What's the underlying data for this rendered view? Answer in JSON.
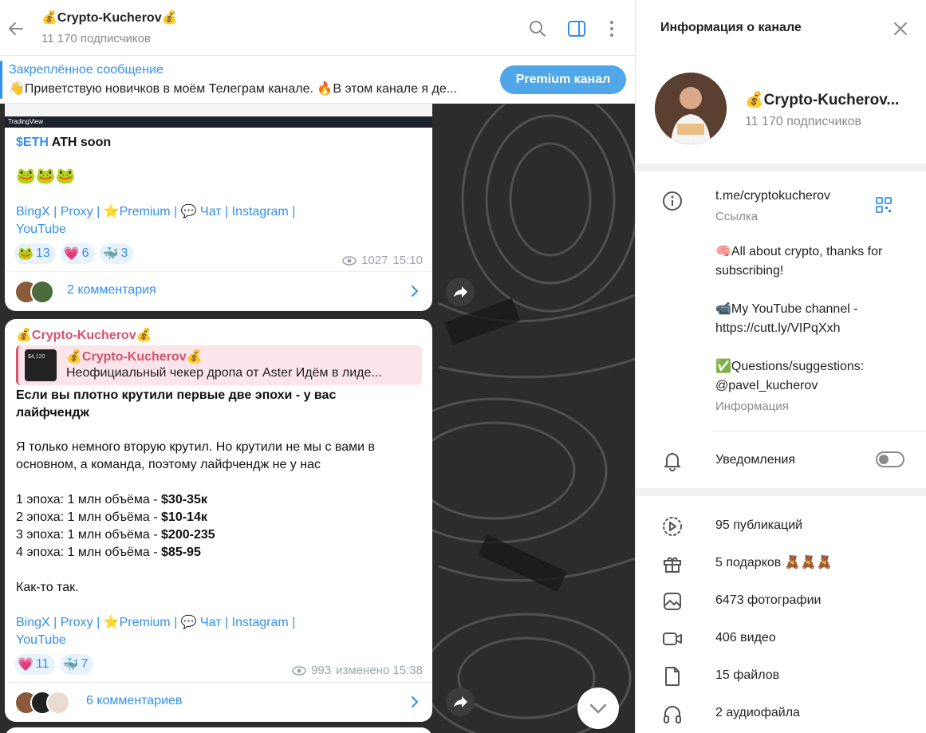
{
  "chat": {
    "title": "💰Crypto-Kucherov💰",
    "subscribers": "11 170 подписчиков",
    "pinned_title": "Закреплённое сообщение",
    "pinned_text": "👋Приветствую новичков в моём Телеграм канале.  🔥В этом канале я де...",
    "premium_button": "Premium канал"
  },
  "post1": {
    "tv_logo": "TradingView",
    "line1_ticker": "$ETH",
    "line1_rest": " ATH soon",
    "emojis": "🐸🐸🐸",
    "links_line1": "BingX | Proxy | ⭐Premium | 💬 Чат | Instagram |",
    "links_line2": "YouTube",
    "reactions": [
      {
        "emoji": "🐸",
        "count": "13"
      },
      {
        "emoji": "💗",
        "count": "6"
      },
      {
        "emoji": "🐳",
        "count": "3"
      }
    ],
    "views": "1027",
    "time": "15:10",
    "comments": "2 комментария"
  },
  "post2": {
    "author": "💰Crypto-Kucherov💰",
    "quote_author": "💰Crypto-Kucherov💰",
    "quote_text": "Неофициальный чекер дропа от Aster  Идём в лиде...",
    "quote_thumb": "$4,120",
    "l1": "Если вы плотно крутили первые две эпохи - у вас",
    "l2": "лайфчендж",
    "l3": "Я только немного вторую крутил. Но крутили не мы с вами в",
    "l4": "основном, а команда, поэтому лайфчендж не у нас",
    "epochs": [
      {
        "label": "1 эпоха: 1 млн объёма - ",
        "value": "$30-35к"
      },
      {
        "label": "2 эпоха: 1 млн объёма - ",
        "value": "$10-14к"
      },
      {
        "label": "3 эпоха: 1 млн объёма - ",
        "value": "$200-235"
      },
      {
        "label": "4 эпоха: 1 млн объёма - ",
        "value": "$85-95"
      }
    ],
    "closing": "Как-то так.",
    "links_line1": "BingX | Proxy | ⭐Premium | 💬 Чат | Instagram |",
    "links_line2": "YouTube",
    "reactions": [
      {
        "emoji": "💗",
        "count": "11"
      },
      {
        "emoji": "🐳",
        "count": "7"
      }
    ],
    "views": "993",
    "time": "изменено 15:38",
    "comments": "6 комментариев"
  },
  "info": {
    "title": "Информация о канале",
    "name": "💰Crypto-Kucherov...",
    "subscribers": "11 170 подписчиков",
    "link": "t.me/cryptokucherov",
    "link_label": "Ссылка",
    "about_1": "🧠All about crypto, thanks for",
    "about_2": "subscribing!",
    "about_3": "📹My YouTube channel  -",
    "about_4": "https://cutt.ly/VIPqXxh",
    "about_5": "✅Questions/suggestions:",
    "about_6": "@pavel_kucherov",
    "about_label": "Информация",
    "notifications": "Уведомления",
    "stats": [
      {
        "icon": "publications-icon",
        "label": "95 публикаций"
      },
      {
        "icon": "gift-icon",
        "label": "5 подарков 🧸🧸🧸"
      },
      {
        "icon": "photo-icon",
        "label": "6473 фотографии"
      },
      {
        "icon": "video-icon",
        "label": "406 видео"
      },
      {
        "icon": "file-icon",
        "label": "15 файлов"
      },
      {
        "icon": "audio-icon",
        "label": "2 аудиофайла"
      }
    ]
  },
  "colors": {
    "accent": "#3390ec",
    "author": "#d7516d",
    "premium": "#4fa6e8"
  }
}
